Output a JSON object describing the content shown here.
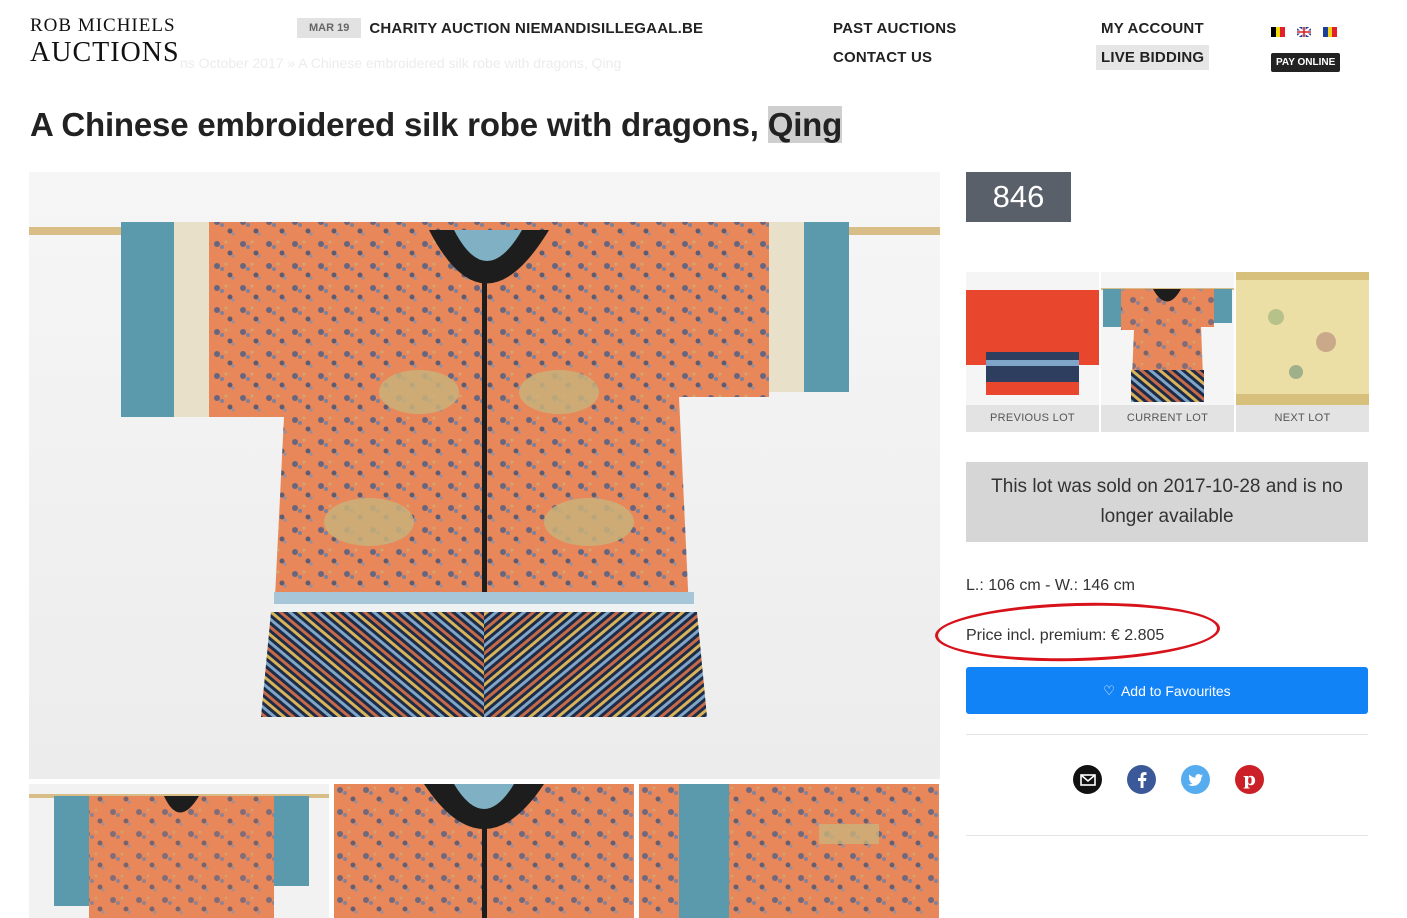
{
  "logo": {
    "line1": "ROB MICHIELS",
    "line2": "AUCTIONS"
  },
  "news": {
    "date": "MAR 19",
    "title": "CHARITY AUCTION NIEMANDISILLEGAAL.BE"
  },
  "nav": {
    "past_auctions": "PAST AUCTIONS",
    "contact_us": "CONTACT US",
    "my_account": "MY ACCOUNT",
    "live_bidding": "LIVE BIDDING",
    "pay_online": "PAY ONLINE"
  },
  "breadcrumb": "ns October 2017  »  A Chinese embroidered silk robe with dragons, Qing",
  "lot": {
    "title_main": "A Chinese embroidered silk robe with dragons, ",
    "title_highlight": "Qing",
    "number": "846",
    "sold_text": "This lot was sold on 2017-10-28 and is no longer available",
    "dimensions": "L.: 106 cm - W.: 146 cm",
    "price": "Price incl. premium: € 2.805"
  },
  "lot_nav": {
    "previous": "PREVIOUS LOT",
    "current": "CURRENT LOT",
    "next": "NEXT LOT"
  },
  "actions": {
    "favourites": "Add to Favourites"
  },
  "icons": [
    "email-icon",
    "facebook-icon",
    "twitter-icon",
    "pinterest-icon"
  ],
  "colors": {
    "accent_blue": "#1283f7",
    "badge_grey": "#5a6069",
    "annotation_red": "#d8121b",
    "robe_orange": "#e8875a",
    "robe_teal": "#5b99ad"
  }
}
